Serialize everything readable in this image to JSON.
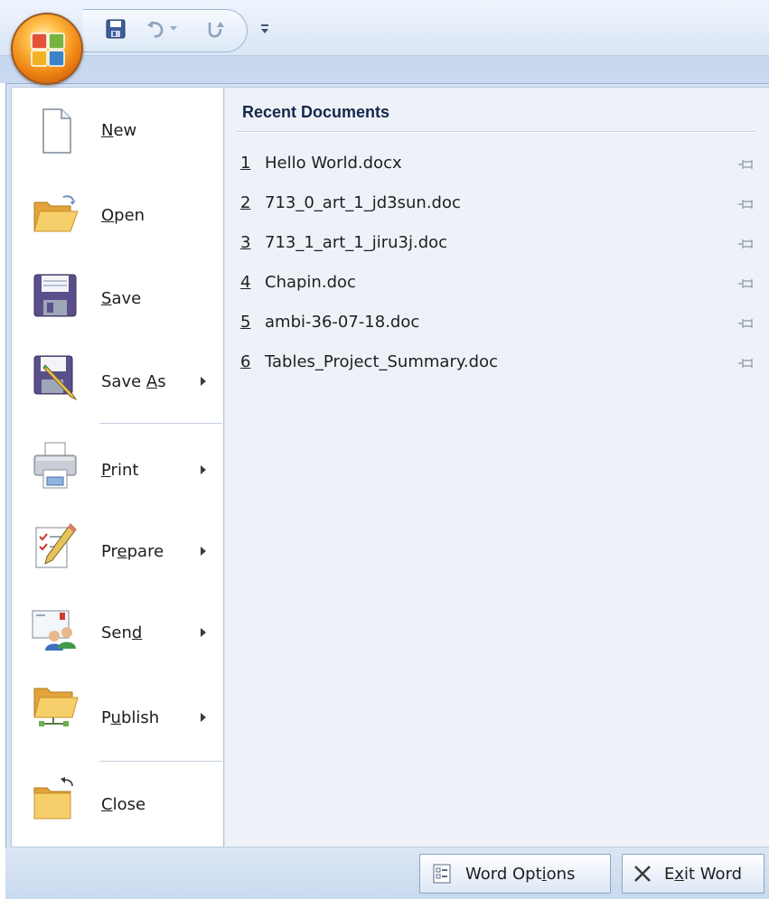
{
  "quick_access": {
    "buttons": [
      {
        "name": "save-quick-button",
        "icon": "floppy-disk-icon"
      },
      {
        "name": "undo-quick-button",
        "icon": "undo-icon"
      },
      {
        "name": "redo-quick-button",
        "icon": "redo-icon"
      }
    ],
    "customize_icon": "dropdown-arrow-icon"
  },
  "menu": {
    "items": [
      {
        "id": "new",
        "pre": "",
        "acc": "N",
        "post": "ew",
        "has_submenu": false,
        "icon": "new-document-icon"
      },
      {
        "id": "open",
        "pre": "",
        "acc": "O",
        "post": "pen",
        "has_submenu": false,
        "icon": "open-folder-icon"
      },
      {
        "id": "save",
        "pre": "",
        "acc": "S",
        "post": "ave",
        "has_submenu": false,
        "icon": "floppy-disk-icon"
      },
      {
        "id": "save-as",
        "pre": "Save ",
        "acc": "A",
        "post": "s",
        "has_submenu": true,
        "icon": "save-as-pencil-icon"
      },
      {
        "id": "print",
        "pre": "",
        "acc": "P",
        "post": "rint",
        "has_submenu": true,
        "icon": "printer-icon"
      },
      {
        "id": "prepare",
        "pre": "Pr",
        "acc": "e",
        "post": "pare",
        "has_submenu": true,
        "icon": "prepare-document-icon"
      },
      {
        "id": "send",
        "pre": "Sen",
        "acc": "d",
        "post": "",
        "has_submenu": true,
        "icon": "send-people-icon"
      },
      {
        "id": "publish",
        "pre": "P",
        "acc": "u",
        "post": "blish",
        "has_submenu": true,
        "icon": "publish-folder-icon"
      },
      {
        "id": "close",
        "pre": "",
        "acc": "C",
        "post": "lose",
        "has_submenu": false,
        "icon": "close-folder-icon"
      }
    ]
  },
  "recent": {
    "header": "Recent Documents",
    "items": [
      {
        "num": "1",
        "name": "Hello World.docx"
      },
      {
        "num": "2",
        "name": "713_0_art_1_jd3sun.doc"
      },
      {
        "num": "3",
        "name": "713_1_art_1_jiru3j.doc"
      },
      {
        "num": "4",
        "name": "Chapin.doc"
      },
      {
        "num": "5",
        "name": "ambi-36-07-18.doc"
      },
      {
        "num": "6",
        "name": "Tables_Project_Summary.doc"
      }
    ],
    "pin_icon": "pushpin-icon"
  },
  "footer": {
    "word_options": {
      "pre": "Word Opt",
      "acc": "i",
      "post": "ons"
    },
    "exit_word": {
      "pre": "E",
      "acc": "x",
      "post": "it Word"
    }
  }
}
